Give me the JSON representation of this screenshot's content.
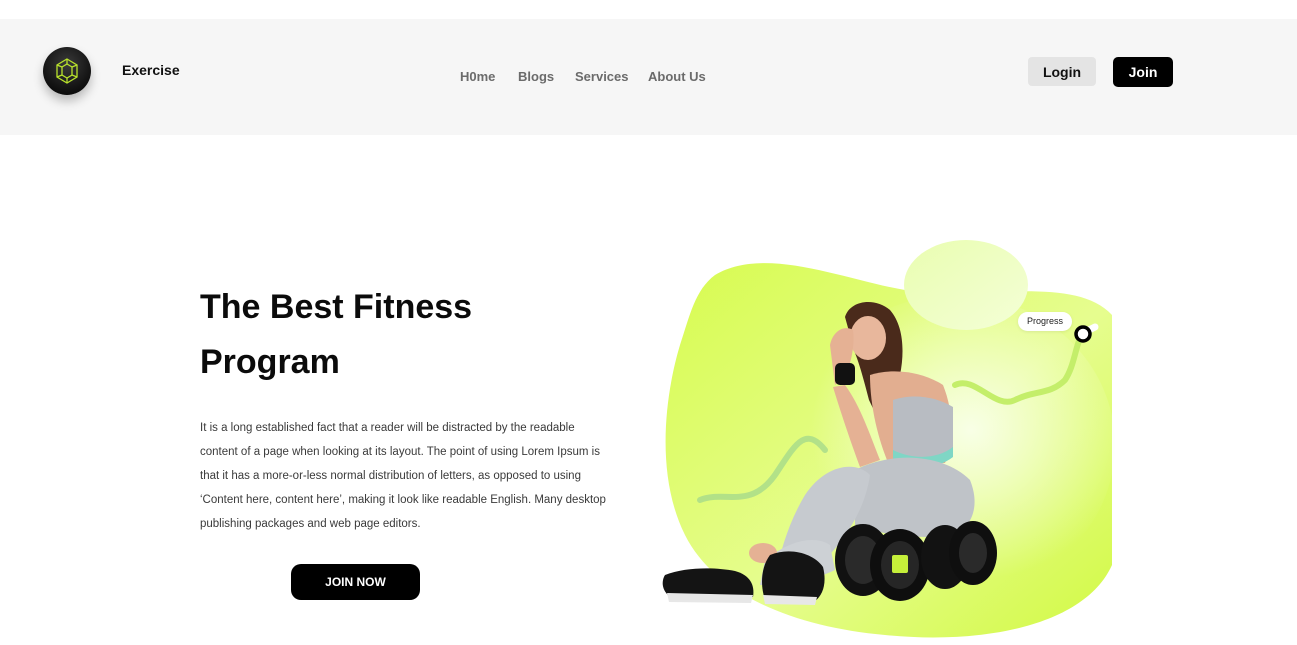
{
  "header": {
    "brand": "Exercise",
    "nav": [
      {
        "label": "H0me"
      },
      {
        "label": "Blogs"
      },
      {
        "label": "Services"
      },
      {
        "label": "About Us"
      }
    ],
    "login_label": "Login",
    "join_label": "Join"
  },
  "hero": {
    "title_line1": "The Best Fitness",
    "title_line2": "Program",
    "description": "It is a long established fact that a reader will be distracted by the readable content of a page when looking at its layout. The point of using Lorem Ipsum is that it has a more-or-less normal distribution of letters, as opposed to using ‘Content here, content here’, making it look like readable English. Many desktop publishing packages and web page editors.",
    "cta_label": "JOIN NOW"
  },
  "illustration": {
    "progress_label": "Progress",
    "accent_color": "#d4fb4a",
    "icons": [
      "logo-icon",
      "fitness-woman-illustration",
      "dumbbell-icon"
    ]
  }
}
